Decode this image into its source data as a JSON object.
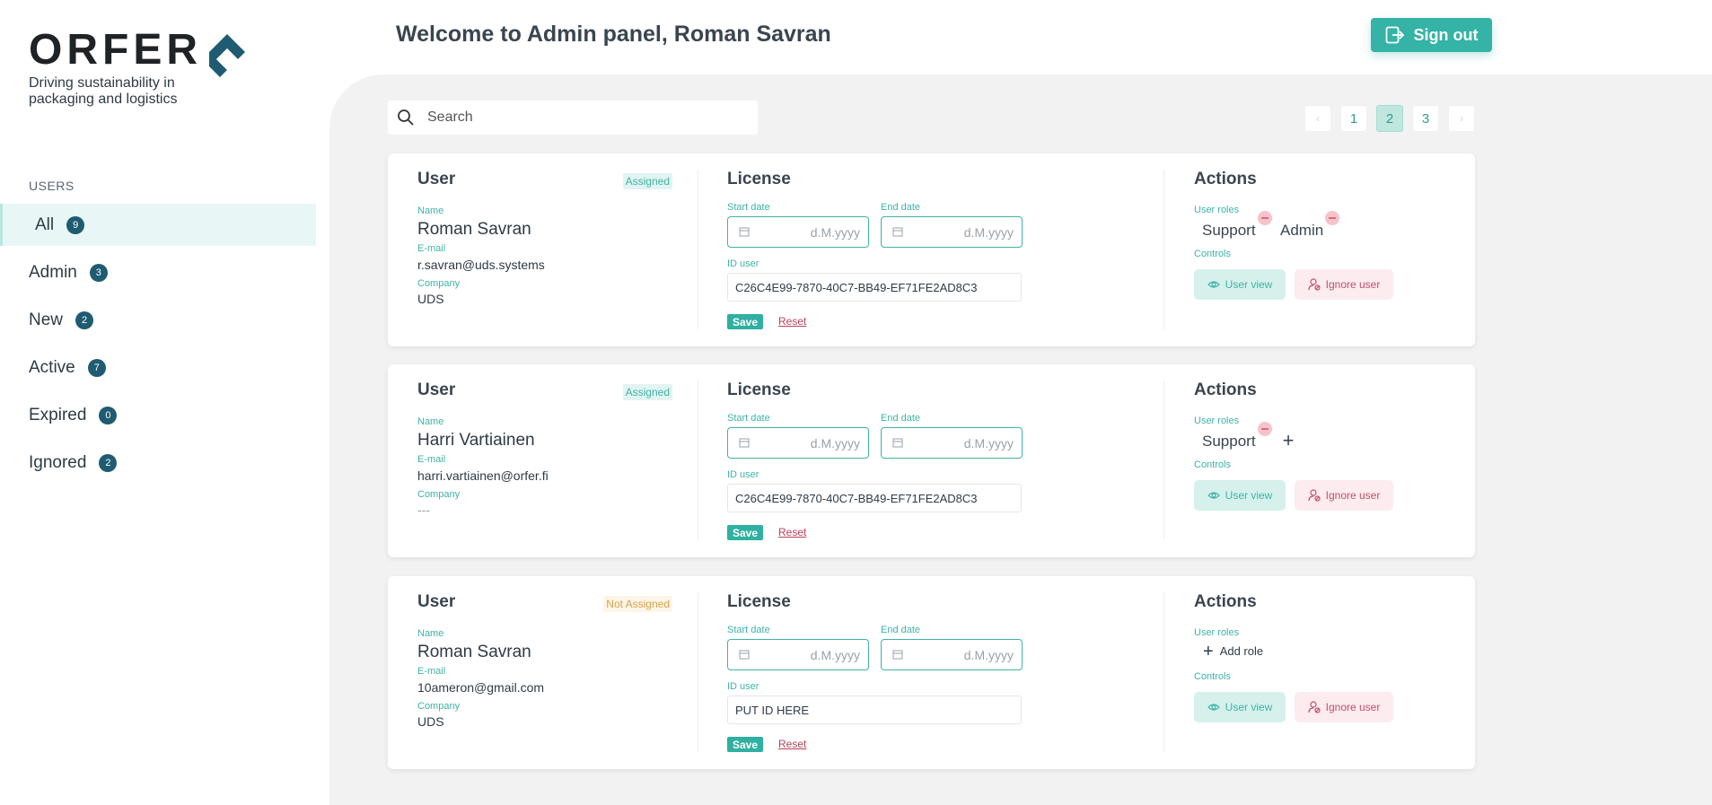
{
  "brand": {
    "logo_word": "ORFER",
    "tagline_line1": "Driving sustainability in",
    "tagline_line2": "packaging and logistics",
    "accent": "#34b3a6",
    "dark": "#1f5c71"
  },
  "sidebar": {
    "section_label": "USERS",
    "items": [
      {
        "label": "All",
        "count": "9"
      },
      {
        "label": "Admin",
        "count": "3"
      },
      {
        "label": "New",
        "count": "2"
      },
      {
        "label": "Active",
        "count": "7"
      },
      {
        "label": "Expired",
        "count": "0"
      },
      {
        "label": "Ignored",
        "count": "2"
      }
    ]
  },
  "header": {
    "title": "Welcome to Admin panel, Roman Savran",
    "sign_out": "Sign out",
    "sign_out_icon": "sign-out-icon"
  },
  "search": {
    "placeholder": "Search",
    "icon": "search-icon"
  },
  "pagination": {
    "pages": [
      "1",
      "2",
      "3"
    ],
    "current": "2",
    "prev": "‹",
    "next": "›"
  },
  "labels": {
    "user_heading": "User",
    "license_heading": "License",
    "actions_heading": "Actions",
    "name": "Name",
    "email": "E-mail",
    "company": "Company",
    "start_date": "Start date",
    "end_date": "End date",
    "date_placeholder": "d.M.yyyy",
    "id_user": "ID user",
    "save": "Save",
    "reset": "Reset",
    "user_roles": "User roles",
    "controls": "Controls",
    "user_view": "User view",
    "ignore_user": "Ignore user",
    "add_role": "Add role"
  },
  "users": [
    {
      "status": "Assigned",
      "name": "Roman Savran",
      "email": "r.savran@uds.systems",
      "company": "UDS",
      "id_user": "C26C4E99-7870-40C7-BB49-EF71FE2AD8C3",
      "roles": [
        "Support",
        "Admin"
      ]
    },
    {
      "status": "Assigned",
      "name": "Harri Vartiainen",
      "email": "harri.vartiainen@orfer.fi",
      "company": "---",
      "id_user": "C26C4E99-7870-40C7-BB49-EF71FE2AD8C3",
      "roles": [
        "Support"
      ]
    },
    {
      "status": "Not Assigned",
      "name": "Roman Savran",
      "email": "10ameron@gmail.com",
      "company": "UDS",
      "id_user": "PUT ID HERE",
      "roles": []
    }
  ]
}
